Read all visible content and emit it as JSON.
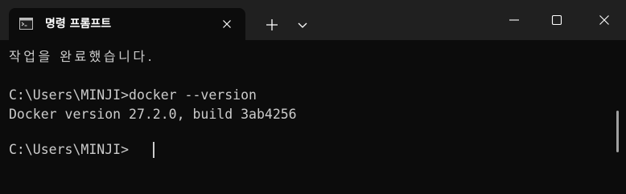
{
  "tab": {
    "title": "명령 프롬프트",
    "icon": "terminal-icon"
  },
  "toolbar": {
    "new_tab_icon": "plus-icon",
    "dropdown_icon": "chevron-down-icon"
  },
  "window_controls": {
    "minimize_icon": "minimize-icon",
    "maximize_icon": "maximize-icon",
    "close_icon": "close-icon"
  },
  "terminal": {
    "lines": [
      "작업을 완료했습니다.",
      "",
      "C:\\Users\\MINJI>docker --version",
      "Docker version 27.2.0, build 3ab4256",
      "",
      "C:\\Users\\MINJI>"
    ]
  },
  "colors": {
    "titlebar_bg": "#202020",
    "terminal_bg": "#0c0c0c",
    "text": "#cccccc"
  }
}
